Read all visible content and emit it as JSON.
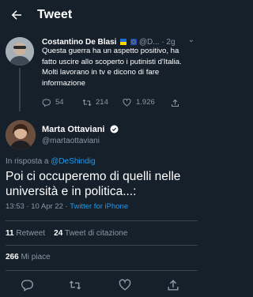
{
  "header": {
    "title": "Tweet"
  },
  "reply_tweet": {
    "author_name": "Costantino De Blasi",
    "author_handle": "@D...",
    "time": "2g",
    "text": "Questa guerra ha un aspetto positivo, ha fatto uscire allo scoperto i putinisti d'Italia. Molti lavorano in tv e dicono di fare informazione",
    "replies": "54",
    "retweets": "214",
    "likes": "1.926"
  },
  "main_tweet": {
    "author_name": "Marta Ottaviani",
    "author_handle": "@martaottaviani",
    "in_reply_prefix": "In risposta a",
    "in_reply_handle": "@DeShindig",
    "text": "Poi ci occuperemo di quelli nelle università e in politica...:",
    "time": "13:53",
    "separator": "·",
    "date": "10 Apr 22",
    "client": "Twitter for iPhone"
  },
  "stats": {
    "retweets_count": "11",
    "retweets_label": "Retweet",
    "quotes_count": "24",
    "quotes_label": "Tweet di citazione",
    "likes_count": "266",
    "likes_label": "Mi piace"
  },
  "colors": {
    "background": "#15202b",
    "accent": "#1d9bf0",
    "secondary_text": "#8b98a5",
    "divider": "#38444d"
  },
  "icons": [
    "back-arrow-icon",
    "flag-icons",
    "more-icon",
    "reply-icon",
    "retweet-icon",
    "like-icon",
    "share-icon",
    "verified-icon"
  ]
}
